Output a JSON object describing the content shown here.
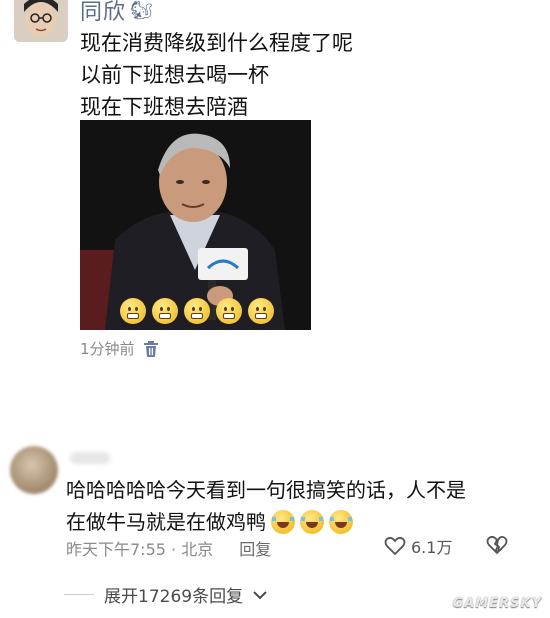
{
  "post": {
    "username": "同欣",
    "username_emoji": "🐿",
    "lines": [
      "现在消费降级到什么程度了呢",
      "以前下班想去喝一杯",
      "现在下班想去陪酒"
    ],
    "image_caption_emojis": 5,
    "time_ago": "1分钟前"
  },
  "comment": {
    "line1": "哈哈哈哈哈今天看到一句很搞笑的话，人不是",
    "line2": "在做牛马就是在做鸡鸭",
    "time": "昨天下午7:55 · 北京",
    "reply_label": "回复",
    "like_count": "6.1万"
  },
  "expand_replies": "展开17269条回复",
  "watermark": "GAMERSKY",
  "colors": {
    "username": "#5b6b8c",
    "meta": "#8a8a8a"
  }
}
